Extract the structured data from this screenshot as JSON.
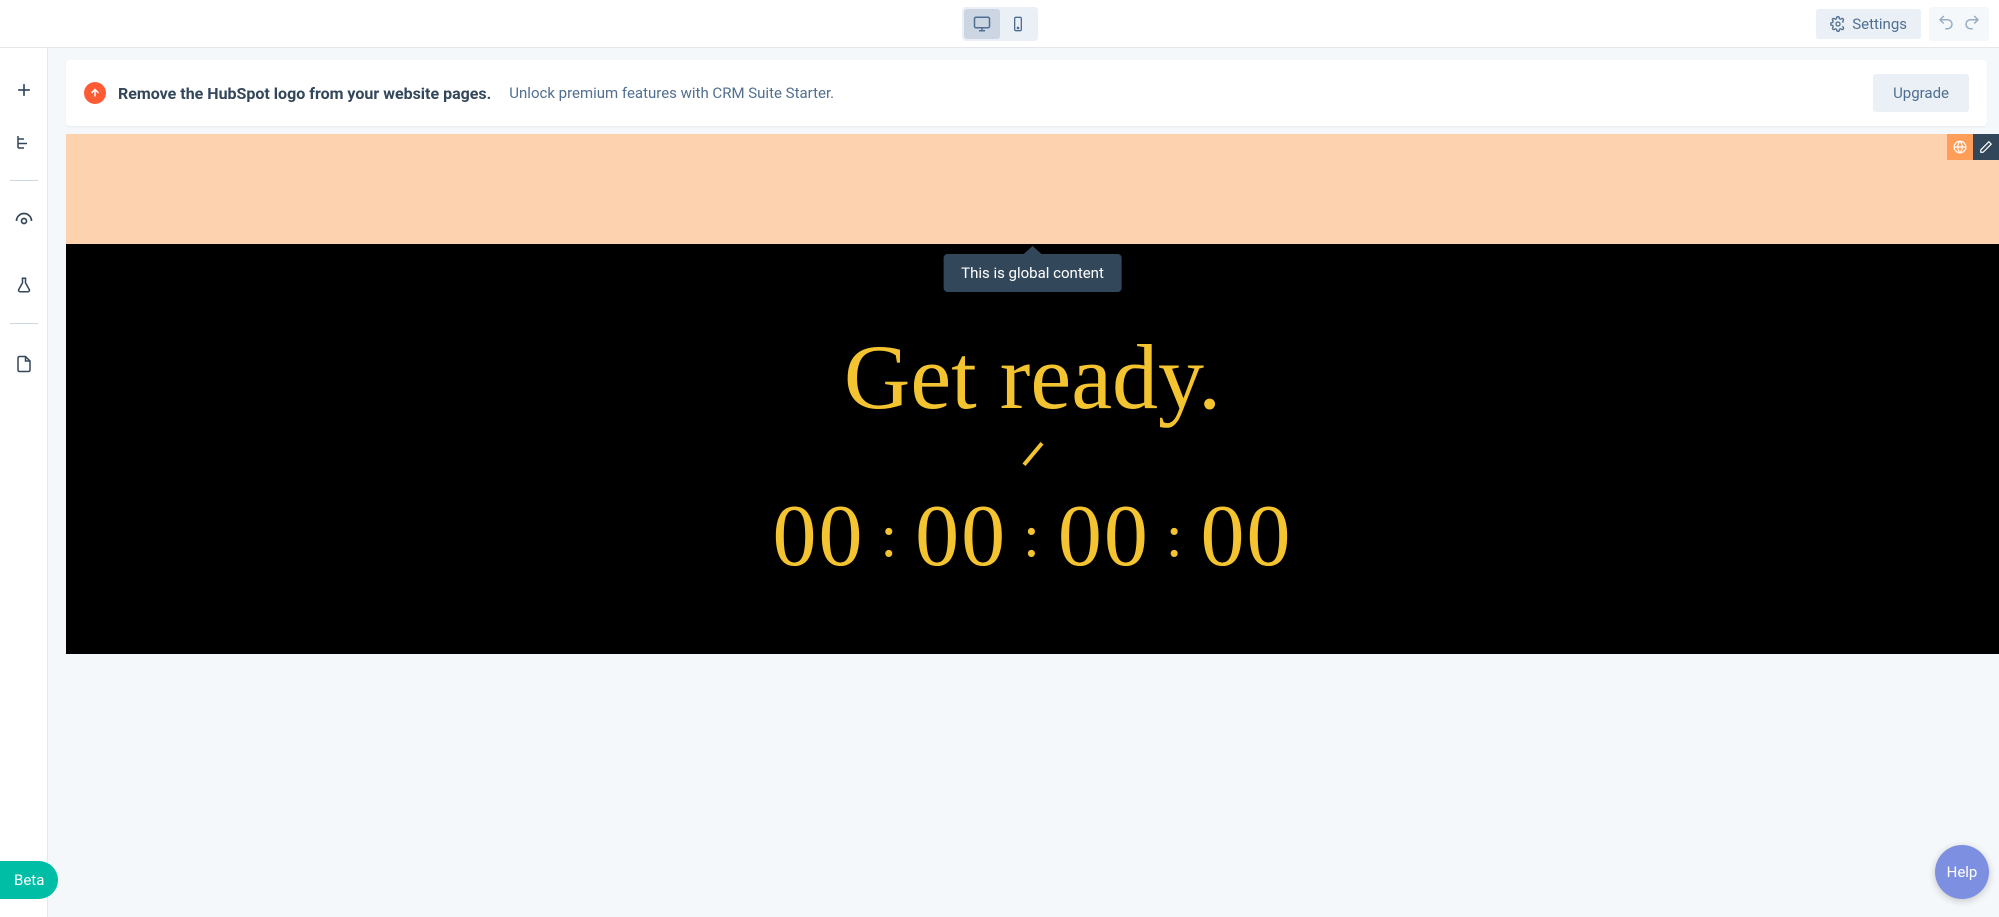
{
  "toolbar": {
    "settings_label": "Settings"
  },
  "banner": {
    "strong": "Remove the HubSpot logo from your website pages.",
    "sub": "Unlock premium features with CRM Suite Starter.",
    "upgrade_label": "Upgrade"
  },
  "tooltip": {
    "text": "This is global content"
  },
  "hero": {
    "title": "Get ready.",
    "countdown": {
      "days": "00",
      "hours": "00",
      "minutes": "00",
      "seconds": "00",
      "sep": ":"
    }
  },
  "beta_label": "Beta",
  "help_label": "Help"
}
